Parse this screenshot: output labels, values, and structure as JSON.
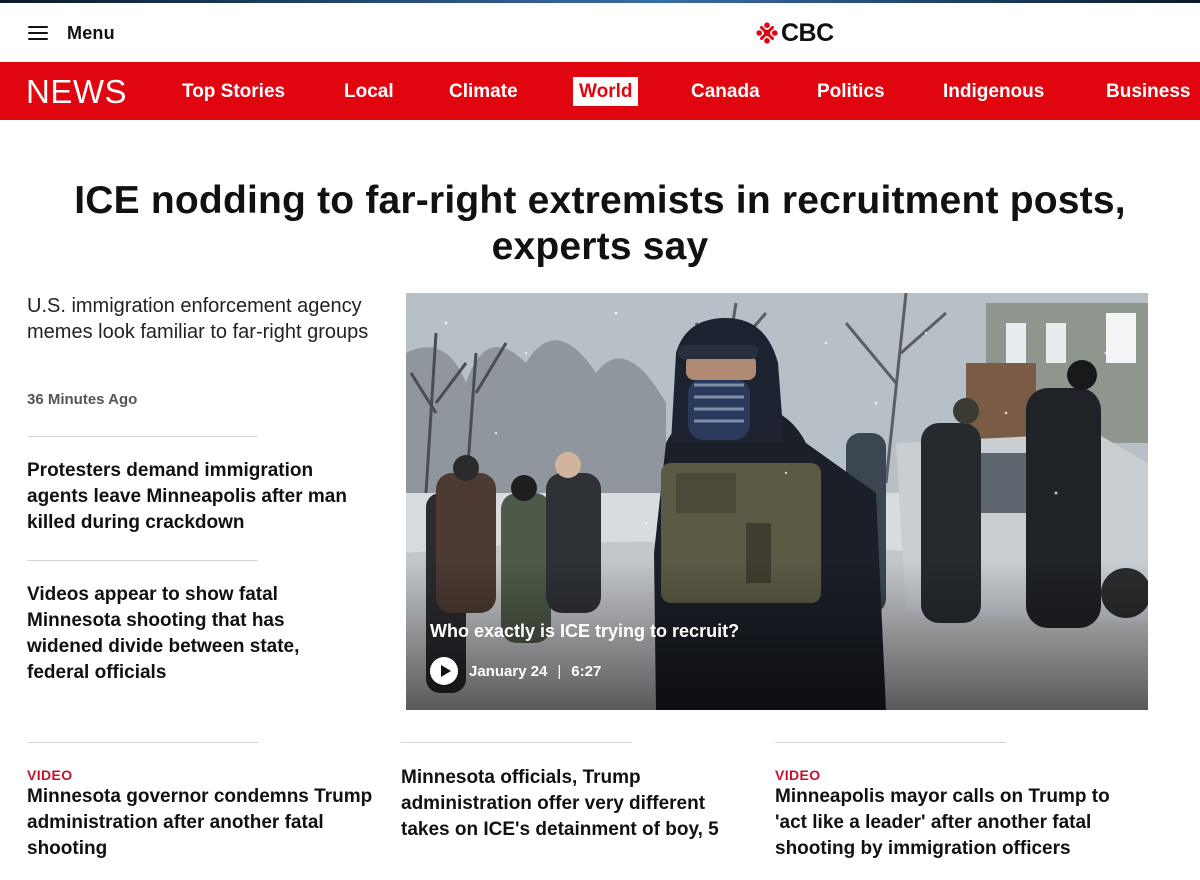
{
  "masthead": {
    "menu_label": "Menu",
    "brand": "CBC"
  },
  "nav": {
    "section_label": "NEWS",
    "items": [
      {
        "label": "Top Stories",
        "active": false
      },
      {
        "label": "Local",
        "active": false
      },
      {
        "label": "Climate",
        "active": false
      },
      {
        "label": "World",
        "active": true
      },
      {
        "label": "Canada",
        "active": false
      },
      {
        "label": "Politics",
        "active": false
      },
      {
        "label": "Indigenous",
        "active": false
      },
      {
        "label": "Business",
        "active": false
      }
    ]
  },
  "lead": {
    "headline_line1": "ICE nodding to far-right extremists in recruitment posts,",
    "headline_line2": "experts say",
    "dek": "U.S. immigration enforcement agency memes look familiar to far-right groups",
    "time": "36 Minutes Ago"
  },
  "side_stories": [
    {
      "title": "Protesters demand immigration agents leave Minneapolis after man killed during crackdown"
    },
    {
      "title": "Videos appear to show fatal Minnesota shooting that has widened divide between state, federal officials"
    }
  ],
  "video": {
    "caption": "Who exactly is ICE trying to recruit?",
    "date": "January 24",
    "separator": "|",
    "duration": "6:27"
  },
  "bottom_stories": [
    {
      "tag": "VIDEO",
      "title": "Minnesota governor condemns Trump administration after another fatal shooting"
    },
    {
      "tag": "",
      "title": "Minnesota officials, Trump administration offer very different takes on ICE's detainment of boy, 5"
    },
    {
      "tag": "VIDEO",
      "title": "Minneapolis mayor calls on Trump to 'act like a leader' after another fatal shooting by immigration officers"
    }
  ],
  "colors": {
    "brand_red": "#e0050f",
    "tag_red": "#c8102e",
    "text": "#111111"
  },
  "icons": [
    "hamburger-menu-icon",
    "cbc-gem-icon",
    "play-icon"
  ]
}
